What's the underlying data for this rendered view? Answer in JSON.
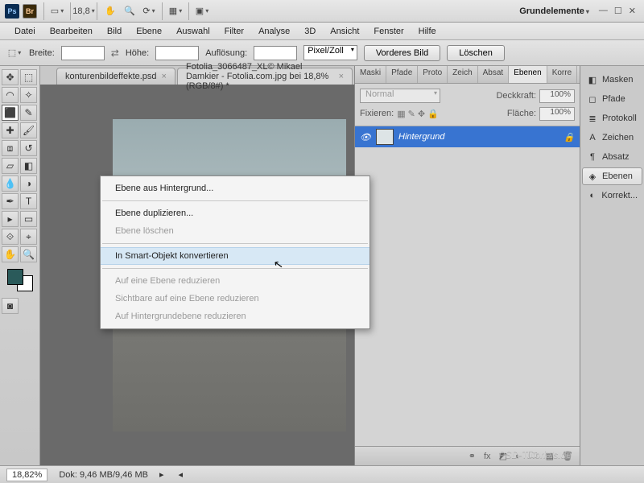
{
  "titlebar": {
    "zoom_menu": "18,8",
    "workspace": "Grundelemente"
  },
  "menubar": {
    "items": [
      "Datei",
      "Bearbeiten",
      "Bild",
      "Ebene",
      "Auswahl",
      "Filter",
      "Analyse",
      "3D",
      "Ansicht",
      "Fenster",
      "Hilfe"
    ]
  },
  "optionsbar": {
    "breite_label": "Breite:",
    "hoehe_label": "Höhe:",
    "aufloesung_label": "Auflösung:",
    "units": "Pixel/Zoll",
    "vorderes": "Vorderes Bild",
    "loeschen": "Löschen"
  },
  "tabs": {
    "t0": {
      "label": "konturenbildeffekte.psd"
    },
    "t1": {
      "label": "Fotolia_3066487_XL© Mikael Damkier - Fotolia.com.jpg bei 18,8% (RGB/8#) *"
    }
  },
  "panels": {
    "tabs": [
      "Maski",
      "Pfade",
      "Proto",
      "Zeich",
      "Absat",
      "Ebenen",
      "Korre"
    ],
    "mode": "Normal",
    "deckkraft_label": "Deckkraft:",
    "deckkraft_val": "100% ",
    "fixieren_label": "Fixieren:",
    "flaeche_label": "Fläche:",
    "flaeche_val": "100% ",
    "layer0": "Hintergrund"
  },
  "dock": {
    "items": [
      {
        "icon": "◧",
        "label": "Masken"
      },
      {
        "icon": "◻",
        "label": "Pfade"
      },
      {
        "icon": "≣",
        "label": "Protokoll"
      },
      {
        "icon": "A",
        "label": "Zeichen"
      },
      {
        "icon": "¶",
        "label": "Absatz"
      },
      {
        "icon": "◈",
        "label": "Ebenen"
      },
      {
        "icon": "◐",
        "label": "Korrekt..."
      }
    ],
    "active": 5
  },
  "status": {
    "zoom": "18,82%",
    "dok": "Dok: 9,46 MB/9,46 MB"
  },
  "watermark": "PSD-Tutorials.de",
  "context_menu": {
    "items": [
      {
        "label": "Ebene aus Hintergrund...",
        "enabled": true
      },
      {
        "sep": true
      },
      {
        "label": "Ebene duplizieren...",
        "enabled": true
      },
      {
        "label": "Ebene löschen",
        "enabled": false
      },
      {
        "sep": true
      },
      {
        "label": "In Smart-Objekt konvertieren",
        "enabled": true,
        "hover": true
      },
      {
        "sep": true
      },
      {
        "label": "Auf eine Ebene reduzieren",
        "enabled": false
      },
      {
        "label": "Sichtbare auf eine Ebene reduzieren",
        "enabled": false
      },
      {
        "label": "Auf Hintergrundebene reduzieren",
        "enabled": false
      }
    ]
  }
}
